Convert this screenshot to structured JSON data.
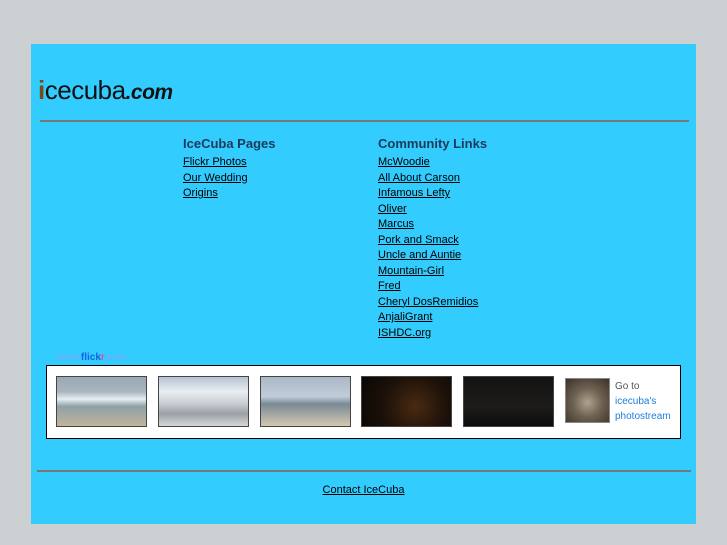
{
  "logo": {
    "first_letter": "i",
    "rest": "cecuba",
    "tld": ".com"
  },
  "left_column": {
    "heading": "IceCuba Pages",
    "links": [
      "Flickr Photos",
      "Our Wedding",
      "Origins"
    ]
  },
  "right_column": {
    "heading": "Community Links",
    "links": [
      "McWoodie",
      "All About Carson",
      "Infamous Lefty",
      "Oliver",
      "Marcus",
      "Pork and Smack",
      "Uncle and Auntie",
      "Mountain-Girl",
      "Fred",
      "Cheryl DosRemidios",
      "AnjaliGrant",
      "ISHDC.org"
    ]
  },
  "flickr_badge": {
    "brand": {
      "prefix": "www.",
      "flick": "flick",
      "r": "r",
      "suffix": ".com"
    },
    "goto_text": "Go to",
    "goto_link_line1": "icecuba's",
    "goto_link_line2": "photostream"
  },
  "footer": {
    "contact_label": "Contact IceCuba"
  },
  "colors": {
    "page_bg": "#33ccff",
    "outer_bg": "#ccd0d2",
    "rule": "#777777"
  }
}
